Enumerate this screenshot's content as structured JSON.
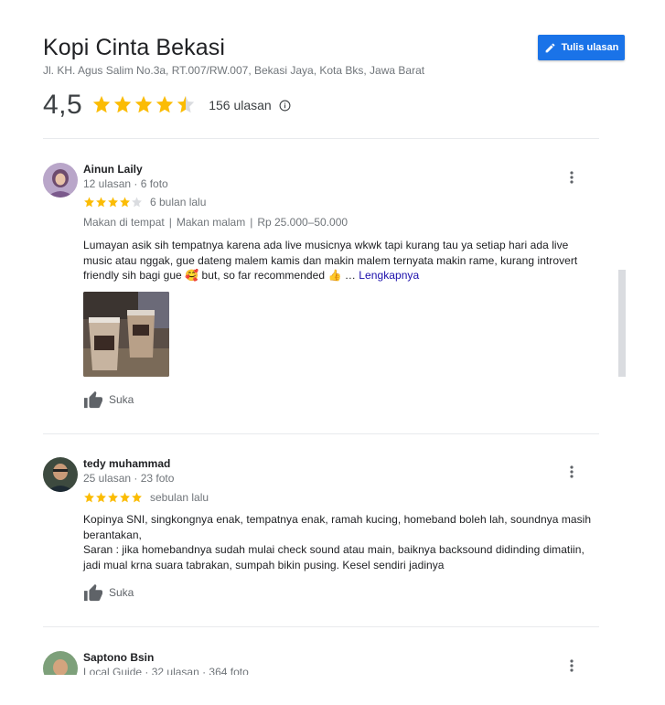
{
  "place": {
    "name": "Kopi Cinta Bekasi",
    "address": "Jl. KH. Agus Salim No.3a, RT.007/RW.007, Bekasi Jaya, Kota Bks, Jawa Barat",
    "rating": "4,5",
    "rating_value": 4.5,
    "review_count": "156 ulasan"
  },
  "write_review": {
    "label": "Tulis ulasan",
    "icon": "pencil-icon"
  },
  "colors": {
    "star": "#fbbc04",
    "star_empty": "#dadce0",
    "primary": "#1a73e8",
    "link": "#1a0dab"
  },
  "reviews": [
    {
      "name": "Ainun Laily",
      "meta": "12 ulasan · 6 foto",
      "stars": 4,
      "date": "6 bulan lalu",
      "attributes": [
        "Makan di tempat",
        "Makan malam",
        "Rp 25.000–50.000"
      ],
      "text": "Lumayan asik sih tempatnya karena ada live musicnya wkwk tapi kurang tau ya setiap hari ada live music atau nggak, gue dateng malem kamis dan makin malem ternyata makin rame, kurang introvert friendly sih bagi gue 🥰 but, so far recommended 👍 …",
      "more": "Lengkapnya",
      "like": "Suka"
    },
    {
      "name": "tedy muhammad",
      "meta": "25 ulasan · 23 foto",
      "stars": 5,
      "date": "sebulan lalu",
      "text_line1": "Kopinya SNI, singkongnya enak, tempatnya enak, ramah kucing, homeband boleh lah, soundnya masih berantakan,",
      "text_line2": "Saran : jika homebandnya sudah mulai check sound atau main, baiknya backsound didinding dimatiin, jadi mual krna suara tabrakan, sumpah bikin pusing. Kesel sendiri jadinya",
      "like": "Suka"
    },
    {
      "name": "Saptono Bsin",
      "meta": "Local Guide · 32 ulasan · 364 foto"
    }
  ]
}
